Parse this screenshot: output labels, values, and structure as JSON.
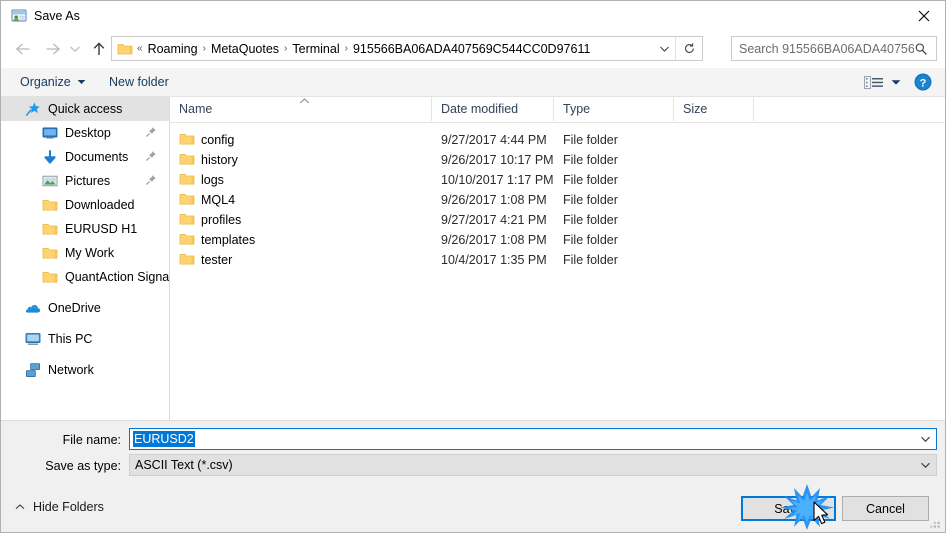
{
  "window": {
    "title": "Save As",
    "icon": "save-as-icon",
    "close_label": "✕"
  },
  "nav": {
    "back_icon": "arrow-left-icon",
    "forward_icon": "arrow-right-icon",
    "recent_icon": "chevron-down-icon",
    "up_icon": "arrow-up-icon",
    "breadcrumb_prefix": "«",
    "breadcrumbs": [
      "Roaming",
      "MetaQuotes",
      "Terminal",
      "915566BA06ADA407569C544CC0D97611"
    ],
    "separator": "›",
    "dropdown_icon": "chevron-down-icon",
    "refresh_icon": "refresh-icon"
  },
  "search": {
    "placeholder": "Search 915566BA06ADA40756...",
    "icon": "magnifier-icon"
  },
  "commandbar": {
    "organize": "Organize",
    "new_folder": "New folder",
    "view_icon": "view-options-icon",
    "view_caret_icon": "chevron-down-icon",
    "help_icon": "help-icon",
    "help_label": "?"
  },
  "sidebar": {
    "items": [
      {
        "label": "Quick access",
        "icon": "star-pin-icon",
        "indent": 0,
        "selected": true,
        "pinned": false
      },
      {
        "label": "Desktop",
        "icon": "desktop-icon",
        "indent": 1,
        "selected": false,
        "pinned": true
      },
      {
        "label": "Documents",
        "icon": "documents-arrow-icon",
        "indent": 1,
        "selected": false,
        "pinned": true
      },
      {
        "label": "Pictures",
        "icon": "pictures-icon",
        "indent": 1,
        "selected": false,
        "pinned": true
      },
      {
        "label": "Downloaded",
        "icon": "folder-icon",
        "indent": 1,
        "selected": false,
        "pinned": false
      },
      {
        "label": "EURUSD H1",
        "icon": "folder-icon",
        "indent": 1,
        "selected": false,
        "pinned": false
      },
      {
        "label": "My Work",
        "icon": "folder-icon",
        "indent": 1,
        "selected": false,
        "pinned": false
      },
      {
        "label": "QuantAction Signal",
        "icon": "folder-icon",
        "indent": 1,
        "selected": false,
        "pinned": false
      },
      {
        "label": "OneDrive",
        "icon": "onedrive-cloud-icon",
        "indent": 0,
        "selected": false,
        "pinned": false,
        "gap_before": true
      },
      {
        "label": "This PC",
        "icon": "this-pc-icon",
        "indent": 0,
        "selected": false,
        "pinned": false,
        "gap_before": true
      },
      {
        "label": "Network",
        "icon": "network-icon",
        "indent": 0,
        "selected": false,
        "pinned": false,
        "gap_before": true
      }
    ]
  },
  "filelist": {
    "columns": [
      "Name",
      "Date modified",
      "Type",
      "Size"
    ],
    "sort_column": "Name",
    "sort_direction": "ascending",
    "rows": [
      {
        "name": "config",
        "date": "9/27/2017 4:44 PM",
        "type": "File folder",
        "size": ""
      },
      {
        "name": "history",
        "date": "9/26/2017 10:17 PM",
        "type": "File folder",
        "size": ""
      },
      {
        "name": "logs",
        "date": "10/10/2017 1:17 PM",
        "type": "File folder",
        "size": ""
      },
      {
        "name": "MQL4",
        "date": "9/26/2017 1:08 PM",
        "type": "File folder",
        "size": ""
      },
      {
        "name": "profiles",
        "date": "9/27/2017 4:21 PM",
        "type": "File folder",
        "size": ""
      },
      {
        "name": "templates",
        "date": "9/26/2017 1:08 PM",
        "type": "File folder",
        "size": ""
      },
      {
        "name": "tester",
        "date": "10/4/2017 1:35 PM",
        "type": "File folder",
        "size": ""
      }
    ]
  },
  "form": {
    "filename_label": "File name:",
    "filename_value": "EURUSD2",
    "filename_selected": true,
    "savetype_label": "Save as type:",
    "savetype_value": "ASCII Text (*.csv)",
    "caret_icon": "chevron-down-icon"
  },
  "footer": {
    "hide_folders": "Hide Folders",
    "hide_folders_icon": "chevron-up-icon",
    "save": "Save",
    "cancel": "Cancel",
    "save_focused": true
  },
  "colors": {
    "accent": "#0078d7",
    "folder_yellow": "#ffd470",
    "window_bg": "#f0f0f0",
    "pane_bg": "#ffffff",
    "header_text": "#33435a",
    "command_text": "#1b3a63"
  }
}
